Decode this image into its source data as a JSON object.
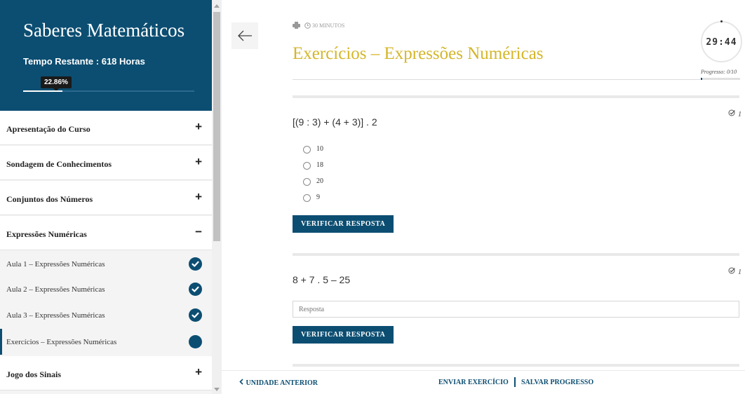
{
  "sidebar": {
    "course_title": "Saberes Matemáticos",
    "time_remaining": "Tempo Restante : 618 Horas",
    "progress_label": "22.86%",
    "progress_fraction": 0.2286,
    "modules": [
      {
        "label": "Apresentação do Curso",
        "toggle": "+"
      },
      {
        "label": "Sondagem de Conhecimentos",
        "toggle": "+"
      },
      {
        "label": "Conjuntos dos Números",
        "toggle": "+"
      },
      {
        "label": "Expressões Numéricas",
        "toggle": "−"
      },
      {
        "label": "Jogo dos Sinais",
        "toggle": "+"
      }
    ],
    "lessons": [
      {
        "label": "Aula 1 – Expressões Numéricas",
        "status": "completed"
      },
      {
        "label": "Aula 2 – Expressões Numéricas",
        "status": "completed"
      },
      {
        "label": "Aula 3 – Expressões Numéricas",
        "status": "completed"
      },
      {
        "label": "Exercícios – Expressões Numéricas",
        "status": "current"
      }
    ]
  },
  "header": {
    "duration": "30 MINUTOS",
    "title": "Exercícios – Expressões Numéricas",
    "timer": "29:44",
    "progress_text": "Progresso: 0/10",
    "progress_fraction": 0.0
  },
  "questions": [
    {
      "text": "[(9 : 3) + (4 + 3)] . 2",
      "points": "1",
      "options": [
        "10",
        "18",
        "20",
        "9"
      ],
      "button": "VERIFICAR RESPOSTA"
    },
    {
      "text": "8 + 7 . 5 – 25",
      "points": "1",
      "input_placeholder": "Resposta",
      "button": "VERIFICAR RESPOSTA"
    }
  ],
  "footer": {
    "previous": "UNIDADE ANTERIOR",
    "send": "ENVIAR EXERCÍCIO",
    "save": "SALVAR PROGRESSO"
  },
  "colors": {
    "primary": "#0c4e72",
    "title_gold": "#d4b62a"
  },
  "icons": {
    "back": "arrow-left-icon",
    "print": "printer-icon",
    "clock": "clock-icon",
    "check": "check-circle-icon",
    "points": "checklist-icon",
    "prev": "chevron-left-icon"
  }
}
